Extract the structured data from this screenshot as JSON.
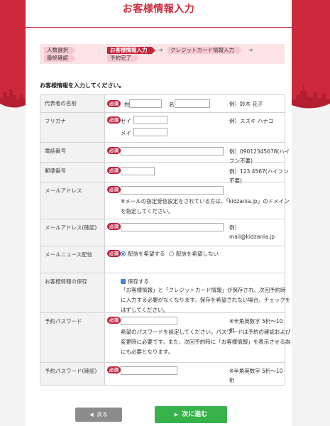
{
  "header": {
    "title": "お客様情報入力"
  },
  "steps": [
    {
      "label": "人数選択"
    },
    {
      "label": "お客様情報入力"
    },
    {
      "label": "クレジットカード情報入力"
    },
    {
      "label": "最終確認"
    },
    {
      "label": "予約完了"
    }
  ],
  "form": {
    "lead": "お客様情報を入力してください。",
    "required_badge": "必須",
    "rows": {
      "name": {
        "label": "代表者の名前",
        "sei_label": "姓",
        "mei_label": "名",
        "example": "例）鈴木 花子"
      },
      "kana": {
        "label": "フリガナ",
        "sei_label": "セイ",
        "mei_label": "メイ",
        "example": "例）スズキ ハナコ"
      },
      "phone": {
        "label": "電話番号",
        "example": "例）09012345678(ハイフン不要)"
      },
      "postal": {
        "label": "郵便番号",
        "example": "例）123 4567(ハイフン不要)"
      },
      "email": {
        "label": "メールアドレス",
        "note": "※メールの指定受信設定をされている方は、「kidzania.jp」のドメインを指定してください。"
      },
      "email_confirm": {
        "label": "メールアドレス(確認)",
        "example": "例）mail@kidzania.jp"
      },
      "newsletter": {
        "label": "メールニュース配信",
        "opt_yes": "配信を希望する",
        "opt_no": "配信を希望しない"
      },
      "save_info": {
        "label": "お客様情報の保存",
        "checkbox_label": "保存する",
        "note": "「お客様情報」と「クレジットカード情報」が保存され、次回予約時に入力する必要がなくなります。保存を希望されない場合、チェックをはずしてください。"
      },
      "password": {
        "label": "予約パスワード",
        "hint": "※半角英数字 5桁〜10桁",
        "note": "希望のパスワードを設定してください。パスワードは予約の確認および変更時に必要です。また、次回予約時に「お客様情報」を表示させる為にも必要となります。"
      },
      "password_confirm": {
        "label": "予約パスワード(確認)",
        "hint": "※半角英数字 5桁〜10桁"
      }
    }
  },
  "buttons": {
    "back": "戻る",
    "next": "次に進む"
  },
  "colors": {
    "brand": "#cc2a3c",
    "next": "#37b24a",
    "back": "#8c8c8c"
  }
}
